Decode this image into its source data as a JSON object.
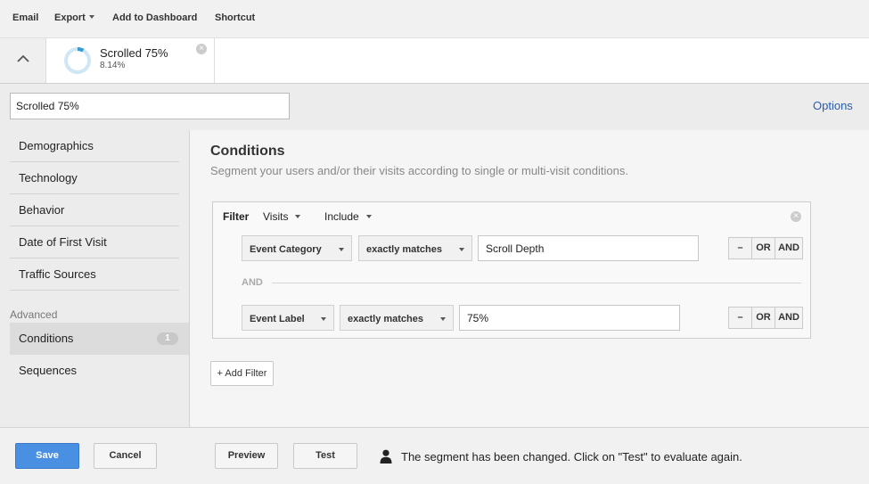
{
  "toolbar": {
    "email": "Email",
    "export": "Export",
    "add_to_dashboard": "Add to Dashboard",
    "shortcut": "Shortcut"
  },
  "segment_chip": {
    "name": "Scrolled 75%",
    "percent": "8.14%",
    "fill_fraction": 0.0814
  },
  "editor": {
    "segment_name": "Scrolled 75%",
    "options_link": "Options"
  },
  "sidebar": {
    "items": [
      {
        "label": "Demographics"
      },
      {
        "label": "Technology"
      },
      {
        "label": "Behavior"
      },
      {
        "label": "Date of First Visit"
      },
      {
        "label": "Traffic Sources"
      }
    ],
    "advanced_label": "Advanced",
    "advanced_items": [
      {
        "label": "Conditions",
        "badge": "1",
        "active": true
      },
      {
        "label": "Sequences"
      }
    ]
  },
  "conditions": {
    "title": "Conditions",
    "subtitle": "Segment your users and/or their visits according to single or multi-visit conditions.",
    "filter": {
      "label": "Filter",
      "scope": "Visits",
      "mode": "Include",
      "rows": [
        {
          "dimension": "Event Category",
          "operator": "exactly matches",
          "value": "Scroll Depth"
        },
        {
          "dimension": "Event Label",
          "operator": "exactly matches",
          "value": "75%"
        }
      ],
      "and_separator": "AND",
      "row_buttons": {
        "minus": "–",
        "or": "OR",
        "and": "AND"
      }
    },
    "add_filter": "+ Add Filter"
  },
  "footer": {
    "save": "Save",
    "cancel": "Cancel",
    "preview": "Preview",
    "test": "Test",
    "status_message": "The segment has been changed. Click on \"Test\" to evaluate again."
  },
  "colors": {
    "accent": "#4a90e2",
    "link": "#2a5db0",
    "donut": "#2f9fd8"
  }
}
